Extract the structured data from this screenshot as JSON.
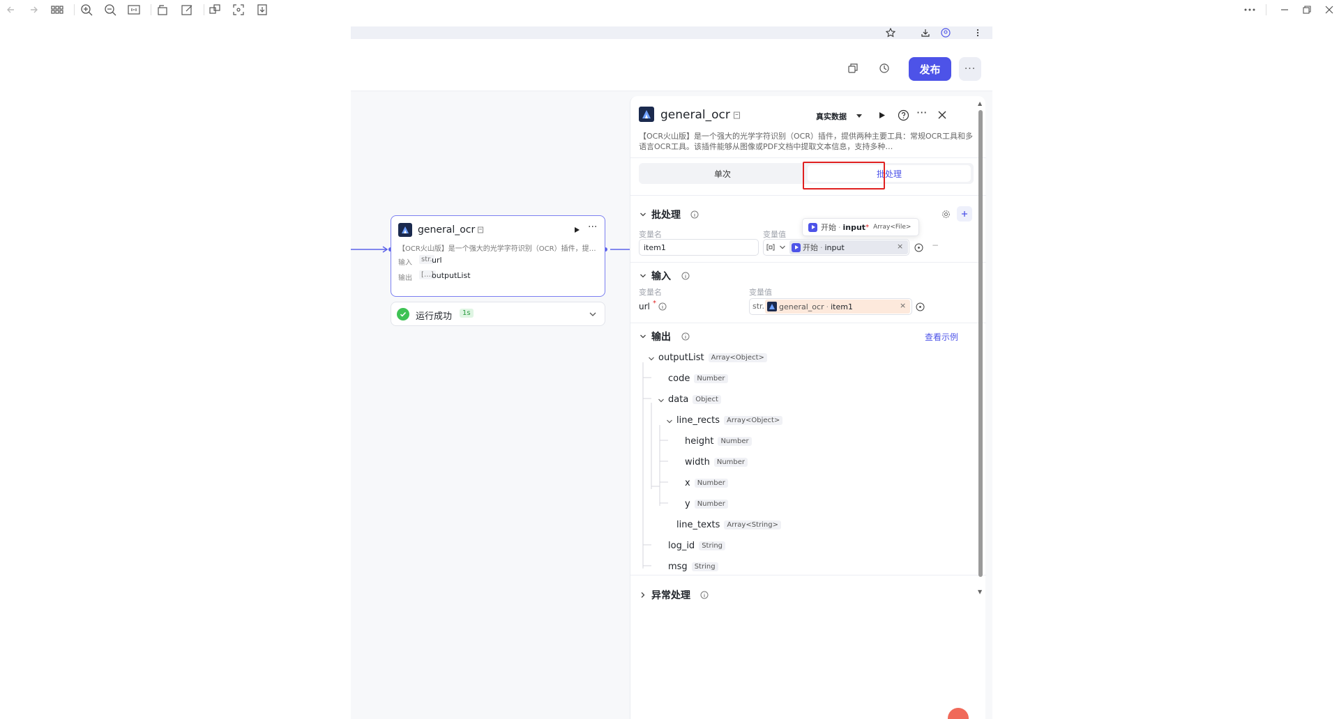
{
  "app": {
    "publish_label": "发布"
  },
  "node": {
    "title": "general_ocr",
    "description": "【OCR火山版】是一个强大的光学字符识别（OCR）插件，提…",
    "input_label": "输入",
    "input_type": "str.",
    "input_name": "url",
    "output_label": "输出",
    "output_type": "[…]",
    "output_name": "outputList",
    "status_text": "运行成功",
    "status_time": "1s"
  },
  "panel": {
    "title": "general_ocr",
    "data_source": "真实数据",
    "description": "【OCR火山版】是一个强大的光学字符识别（OCR）插件，提供两种主要工具：常规OCR工具和多语言OCR工具。该插件能够从图像或PDF文档中提取文本信息，支持多种…",
    "tabs": [
      {
        "label": "单次",
        "active": false
      },
      {
        "label": "批处理",
        "active": true
      }
    ],
    "batch": {
      "title": "批处理",
      "col_name": "变量名",
      "col_value": "变量值",
      "tooltip_prefix": "开始",
      "tooltip_var": "input",
      "tooltip_type": "Array<File>",
      "var_name_value": "item1",
      "ref_prefix": "开始",
      "ref_var": "input"
    },
    "inputs": {
      "title": "输入",
      "col_name": "变量名",
      "col_value": "变量值",
      "param_name": "url",
      "param_type": "str.",
      "ref_node": "general_ocr",
      "ref_var": "item1"
    },
    "outputs": {
      "title": "输出",
      "view_example": "查看示例",
      "tree": [
        {
          "name": "outputList",
          "type": "Array<Object>",
          "level": 0,
          "expanded": true
        },
        {
          "name": "code",
          "type": "Number",
          "level": 1
        },
        {
          "name": "data",
          "type": "Object",
          "level": 1,
          "expanded": true
        },
        {
          "name": "line_rects",
          "type": "Array<Object>",
          "level": 2,
          "expanded": true
        },
        {
          "name": "height",
          "type": "Number",
          "level": 3
        },
        {
          "name": "width",
          "type": "Number",
          "level": 3
        },
        {
          "name": "x",
          "type": "Number",
          "level": 3
        },
        {
          "name": "y",
          "type": "Number",
          "level": 3
        },
        {
          "name": "line_texts",
          "type": "Array<String>",
          "level": 2
        },
        {
          "name": "log_id",
          "type": "String",
          "level": 1
        },
        {
          "name": "msg",
          "type": "String",
          "level": 1
        }
      ]
    },
    "exception": {
      "title": "异常处理"
    }
  },
  "colors": {
    "accent": "#4d53e8",
    "success": "#3ec254",
    "highlight_border": "#e02020",
    "ref_bg": "#fde9dc"
  },
  "icons": [
    "back-icon",
    "forward-icon",
    "grid-icon",
    "zoom-in-icon",
    "zoom-out-icon",
    "fit-icon",
    "rotate-icon",
    "edit-icon",
    "crop-icon",
    "fullscreen-icon",
    "download-icon",
    "star-icon",
    "copy-icon",
    "history-icon",
    "play-icon",
    "help-icon",
    "close-icon",
    "gear-icon",
    "plus-icon",
    "info-icon",
    "chevron-down-icon"
  ]
}
